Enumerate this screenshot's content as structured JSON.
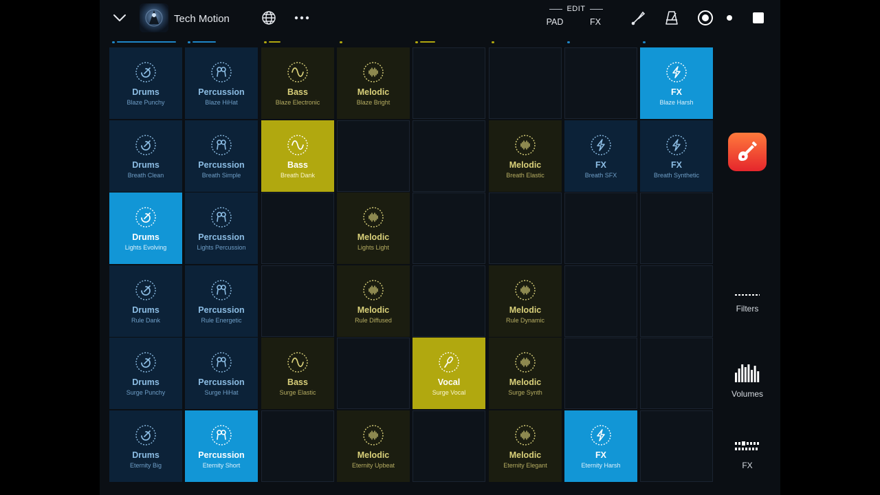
{
  "header": {
    "title": "Tech Motion",
    "edit_label": "EDIT",
    "pad_label": "PAD",
    "fx_label": "FX"
  },
  "colors": {
    "blue_pad": "#0c2238",
    "blue_active": "#1296d6",
    "olive_pad": "#1b1d10",
    "olive_active": "#b1a80f",
    "app_background": "#0b0f14",
    "blue_text": "#8cbde4",
    "olive_text": "#d9d07a"
  },
  "column_progress": [
    {
      "color": "#1e86c8",
      "level": 1.0
    },
    {
      "color": "#1e86c8",
      "level": 0.4
    },
    {
      "color": "#b1a80f",
      "level": 0.2
    },
    {
      "color": "#b1a80f",
      "level": 0.0
    },
    {
      "color": "#b1a80f",
      "level": 0.25
    },
    {
      "color": "#b1a80f",
      "level": 0.0
    },
    {
      "color": "#1e86c8",
      "level": 0.0
    },
    {
      "color": "#1e86c8",
      "level": 0.0
    }
  ],
  "grid": {
    "rows": [
      [
        {
          "category": "Drums",
          "name": "Blaze Punchy",
          "color": "blue",
          "icon": "drums-icon",
          "active": false
        },
        {
          "category": "Percussion",
          "name": "Blaze HiHat",
          "color": "blue",
          "icon": "percussion-icon",
          "active": false
        },
        {
          "category": "Bass",
          "name": "Blaze Electronic",
          "color": "olive",
          "icon": "bass-wave-icon",
          "active": false
        },
        {
          "category": "Melodic",
          "name": "Blaze Bright",
          "color": "olive",
          "icon": "melodic-waveform-icon",
          "active": false
        },
        null,
        null,
        null,
        {
          "category": "FX",
          "name": "Blaze Harsh",
          "color": "blue",
          "icon": "fx-bolt-icon",
          "active": true
        }
      ],
      [
        {
          "category": "Drums",
          "name": "Breath Clean",
          "color": "blue",
          "icon": "drums-icon",
          "active": false
        },
        {
          "category": "Percussion",
          "name": "Breath Simple",
          "color": "blue",
          "icon": "percussion-icon",
          "active": false
        },
        {
          "category": "Bass",
          "name": "Breath Dank",
          "color": "olive",
          "icon": "bass-wave-icon",
          "active": true
        },
        null,
        null,
        {
          "category": "Melodic",
          "name": "Breath Elastic",
          "color": "olive",
          "icon": "melodic-waveform-icon",
          "active": false
        },
        {
          "category": "FX",
          "name": "Breath SFX",
          "color": "blue",
          "icon": "fx-bolt-icon",
          "active": false
        },
        {
          "category": "FX",
          "name": "Breath Synthetic",
          "color": "blue",
          "icon": "fx-bolt-icon",
          "active": false
        }
      ],
      [
        {
          "category": "Drums",
          "name": "Lights Evolving",
          "color": "blue",
          "icon": "drums-icon",
          "active": true
        },
        {
          "category": "Percussion",
          "name": "Lights Percussion",
          "color": "blue",
          "icon": "percussion-icon",
          "active": false
        },
        null,
        {
          "category": "Melodic",
          "name": "Lights Light",
          "color": "olive",
          "icon": "melodic-waveform-icon",
          "active": false
        },
        null,
        null,
        null,
        null
      ],
      [
        {
          "category": "Drums",
          "name": "Rule Dank",
          "color": "blue",
          "icon": "drums-icon",
          "active": false
        },
        {
          "category": "Percussion",
          "name": "Rule Energetic",
          "color": "blue",
          "icon": "percussion-icon",
          "active": false
        },
        null,
        {
          "category": "Melodic",
          "name": "Rule Diffused",
          "color": "olive",
          "icon": "melodic-waveform-icon",
          "active": false
        },
        null,
        {
          "category": "Melodic",
          "name": "Rule Dynamic",
          "color": "olive",
          "icon": "melodic-waveform-icon",
          "active": false
        },
        null,
        null
      ],
      [
        {
          "category": "Drums",
          "name": "Surge Punchy",
          "color": "blue",
          "icon": "drums-icon",
          "active": false
        },
        {
          "category": "Percussion",
          "name": "Surge HiHat",
          "color": "blue",
          "icon": "percussion-icon",
          "active": false
        },
        {
          "category": "Bass",
          "name": "Surge Elastic",
          "color": "olive",
          "icon": "bass-wave-icon",
          "active": false
        },
        null,
        {
          "category": "Vocal",
          "name": "Surge Vocal",
          "color": "olive",
          "icon": "vocal-mic-icon",
          "active": true
        },
        {
          "category": "Melodic",
          "name": "Surge Synth",
          "color": "olive",
          "icon": "melodic-waveform-icon",
          "active": false
        },
        null,
        null
      ],
      [
        {
          "category": "Drums",
          "name": "Eternity Big",
          "color": "blue",
          "icon": "drums-icon",
          "active": false
        },
        {
          "category": "Percussion",
          "name": "Eternity Short",
          "color": "blue",
          "icon": "percussion-icon",
          "active": true
        },
        null,
        {
          "category": "Melodic",
          "name": "Eternity Upbeat",
          "color": "olive",
          "icon": "melodic-waveform-icon",
          "active": false
        },
        null,
        {
          "category": "Melodic",
          "name": "Eternity Elegant",
          "color": "olive",
          "icon": "melodic-waveform-icon",
          "active": false
        },
        {
          "category": "FX",
          "name": "Eternity Harsh",
          "color": "blue",
          "icon": "fx-bolt-icon",
          "active": true
        },
        null
      ]
    ]
  },
  "side_panel": {
    "filters_label": "Filters",
    "volumes_label": "Volumes",
    "fx_label": "FX"
  }
}
